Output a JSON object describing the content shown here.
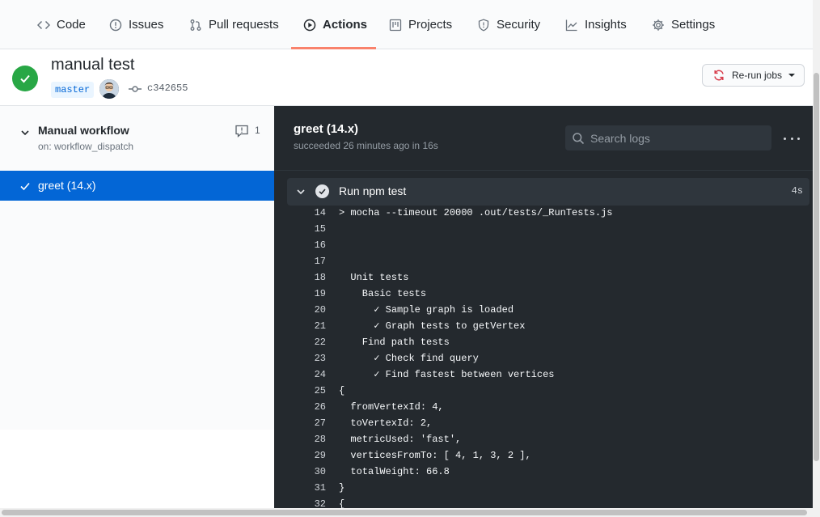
{
  "nav": {
    "tabs": [
      {
        "label": "Code",
        "icon": "code-icon"
      },
      {
        "label": "Issues",
        "icon": "issue-icon"
      },
      {
        "label": "Pull requests",
        "icon": "pull-request-icon"
      },
      {
        "label": "Actions",
        "icon": "play-icon",
        "active": true
      },
      {
        "label": "Projects",
        "icon": "project-icon"
      },
      {
        "label": "Security",
        "icon": "shield-icon"
      },
      {
        "label": "Insights",
        "icon": "graph-icon"
      },
      {
        "label": "Settings",
        "icon": "gear-icon"
      }
    ]
  },
  "run": {
    "title": "manual test",
    "branch": "master",
    "commit_sha": "c342655",
    "rerun_label": "Re-run jobs",
    "status_color": "#28a745"
  },
  "sidebar": {
    "workflow_title": "Manual workflow",
    "workflow_trigger": "on: workflow_dispatch",
    "comment_count": "1",
    "job_label": "greet (14.x)",
    "selected_color": "#0366d6"
  },
  "log": {
    "job_title": "greet (14.x)",
    "job_status": "succeeded 26 minutes ago in 16s",
    "search_placeholder": "Search logs",
    "step_name": "Run npm test",
    "step_duration": "4s",
    "lines": [
      {
        "n": "14",
        "t": "> mocha --timeout 20000 .out/tests/_RunTests.js"
      },
      {
        "n": "15",
        "t": ""
      },
      {
        "n": "16",
        "t": ""
      },
      {
        "n": "17",
        "t": ""
      },
      {
        "n": "18",
        "t": "  Unit tests"
      },
      {
        "n": "19",
        "t": "    Basic tests"
      },
      {
        "n": "20",
        "t": "      ✓ Sample graph is loaded"
      },
      {
        "n": "21",
        "t": "      ✓ Graph tests to getVertex"
      },
      {
        "n": "22",
        "t": "    Find path tests"
      },
      {
        "n": "23",
        "t": "      ✓ Check find query"
      },
      {
        "n": "24",
        "t": "      ✓ Find fastest between vertices"
      },
      {
        "n": "25",
        "t": "{"
      },
      {
        "n": "26",
        "t": "  fromVertexId: 4,"
      },
      {
        "n": "27",
        "t": "  toVertexId: 2,"
      },
      {
        "n": "28",
        "t": "  metricUsed: 'fast',"
      },
      {
        "n": "29",
        "t": "  verticesFromTo: [ 4, 1, 3, 2 ],"
      },
      {
        "n": "30",
        "t": "  totalWeight: 66.8"
      },
      {
        "n": "31",
        "t": "}"
      },
      {
        "n": "32",
        "t": "{"
      }
    ]
  }
}
